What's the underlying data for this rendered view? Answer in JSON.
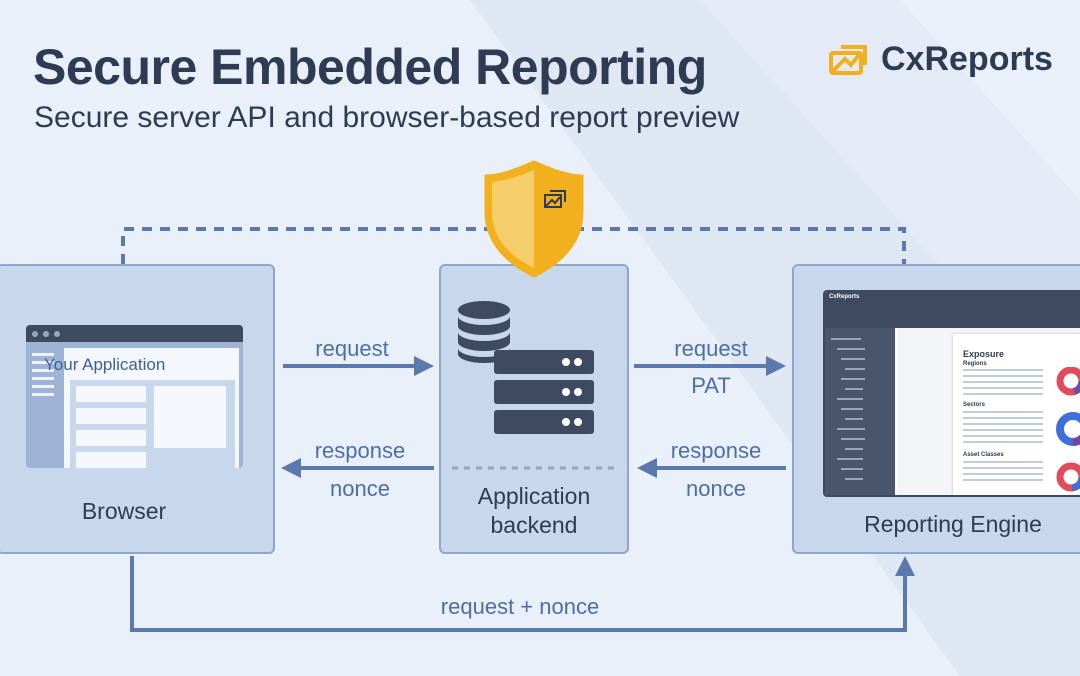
{
  "header": {
    "title": "Secure Embedded Reporting",
    "subtitle": "Secure server API and browser-based report preview"
  },
  "logo": {
    "name": "CxReports"
  },
  "nodes": {
    "browser": {
      "label": "Browser",
      "app_window_title": "Your Application"
    },
    "backend": {
      "label_line1": "Application",
      "label_line2": "backend"
    },
    "engine": {
      "label": "Reporting Engine",
      "preview": {
        "app_name": "CxReports",
        "heading": "Exposure",
        "section1": "Regions",
        "section2": "Sectors",
        "section3": "Asset Classes"
      }
    }
  },
  "edges": {
    "browser_to_backend": "request",
    "backend_to_browser_line1": "response",
    "backend_to_browser_line2": "nonce",
    "backend_to_engine_line1": "request",
    "backend_to_engine_line2": "PAT",
    "engine_to_backend_line1": "response",
    "engine_to_backend_line2": "nonce",
    "browser_to_engine": "request + nonce"
  },
  "colors": {
    "background": "#eaf0f9",
    "box_fill": "#c9d7ec",
    "box_border": "#8ea6cc",
    "arrow": "#5b79ad",
    "dark": "#2f3b52",
    "shield_gold": "#f2b01e",
    "shield_light": "#f5cd6a"
  }
}
